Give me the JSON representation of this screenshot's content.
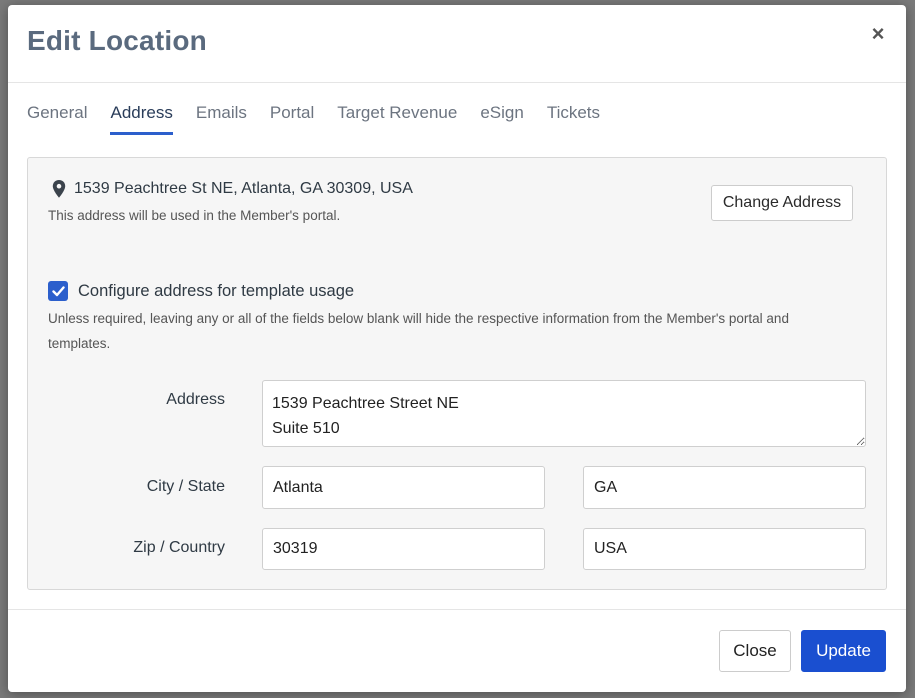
{
  "modal": {
    "title": "Edit Location",
    "close_icon": "close-icon"
  },
  "tabs": [
    {
      "label": "General",
      "active": false
    },
    {
      "label": "Address",
      "active": true
    },
    {
      "label": "Emails",
      "active": false
    },
    {
      "label": "Portal",
      "active": false
    },
    {
      "label": "Target Revenue",
      "active": false
    },
    {
      "label": "eSign",
      "active": false
    },
    {
      "label": "Tickets",
      "active": false
    }
  ],
  "address_panel": {
    "pin_icon": "map-pin-icon",
    "full_address": "1539 Peachtree St NE, Atlanta, GA 30309, USA",
    "note": "This address will be used in the Member's portal.",
    "change_button": "Change Address"
  },
  "template_config": {
    "checked": true,
    "label": "Configure address for template usage",
    "note": "Unless required, leaving any or all of the fields below blank will hide the respective information from the Member's portal and templates."
  },
  "form": {
    "address_label": "Address",
    "address_value": "1539 Peachtree Street NE\nSuite 510",
    "city_state_label": "City / State",
    "city_value": "Atlanta",
    "state_value": "GA",
    "zip_country_label": "Zip / Country",
    "zip_value": "30319",
    "country_value": "USA"
  },
  "footer": {
    "close_button": "Close",
    "update_button": "Update"
  },
  "colors": {
    "accent": "#2c5fcc",
    "primary_button": "#1a4fd0",
    "title": "#5a6a7e"
  }
}
